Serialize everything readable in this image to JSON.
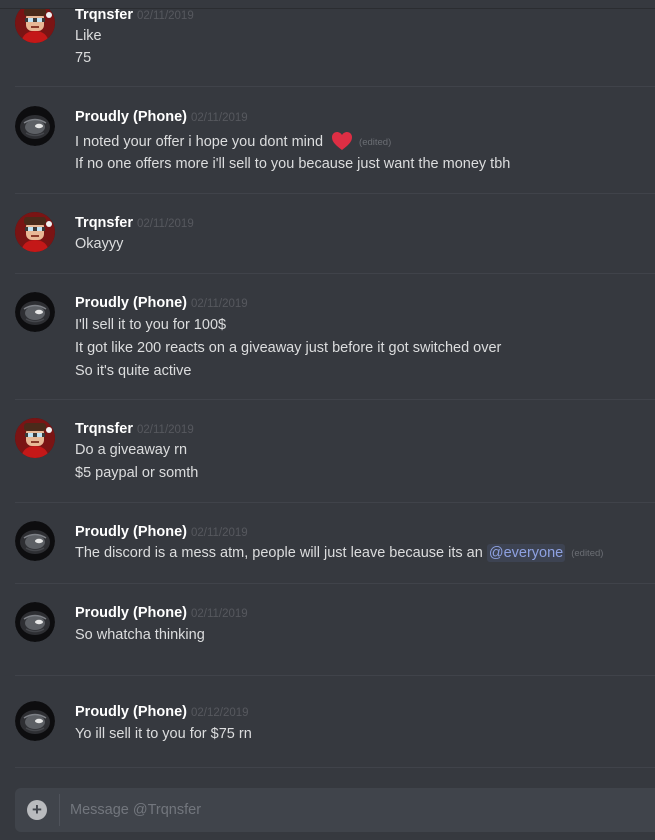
{
  "colors": {
    "background": "#36393f",
    "author": "#ffffff",
    "message_text": "#dcddde",
    "timestamp": "#56585e",
    "mention": "#8ea1e1",
    "heart": "#dd2e44",
    "composer": "#40444b"
  },
  "messages": [
    {
      "author": "Trqnsfer",
      "timestamp": "02/11/2019",
      "avatar": "cartoon-avatar-icon",
      "lines": [
        "Like",
        "75"
      ]
    },
    {
      "author": "Proudly (Phone)",
      "timestamp": "02/11/2019",
      "avatar": "dark-disc-avatar-icon",
      "lines": [
        "I noted your offer i hope you dont mind",
        "If no one offers more i'll sell to you because just want the money tbh"
      ],
      "edited": "(edited)",
      "emoji": "heart-emoji-icon"
    },
    {
      "author": "Trqnsfer",
      "timestamp": "02/11/2019",
      "avatar": "cartoon-avatar-icon",
      "lines": [
        "Okayyy"
      ]
    },
    {
      "author": "Proudly (Phone)",
      "timestamp": "02/11/2019",
      "avatar": "dark-disc-avatar-icon",
      "lines": [
        "I'll sell it to you for 100$",
        "It got like 200 reacts on a giveaway just before it got switched over",
        "So it's quite active"
      ]
    },
    {
      "author": "Trqnsfer",
      "timestamp": "02/11/2019",
      "avatar": "cartoon-avatar-icon",
      "lines": [
        "Do a giveaway rn",
        "$5 paypal or somth"
      ]
    },
    {
      "author": "Proudly (Phone)",
      "timestamp": "02/11/2019",
      "avatar": "dark-disc-avatar-icon",
      "lines": [
        "The discord is a mess atm, people will just leave because its an"
      ],
      "mention": "@everyone",
      "edited": "(edited)"
    },
    {
      "author": "Proudly (Phone)",
      "timestamp": "02/11/2019",
      "avatar": "dark-disc-avatar-icon",
      "lines": [
        "So whatcha thinking"
      ]
    },
    {
      "author": "Proudly (Phone)",
      "timestamp": "02/12/2019",
      "avatar": "dark-disc-avatar-icon",
      "lines": [
        "Yo ill sell it to you for $75 rn"
      ]
    }
  ],
  "composer": {
    "placeholder": "Message @Trqnsfer",
    "plus_icon": "plus-circle-icon",
    "plus_label": "+"
  }
}
